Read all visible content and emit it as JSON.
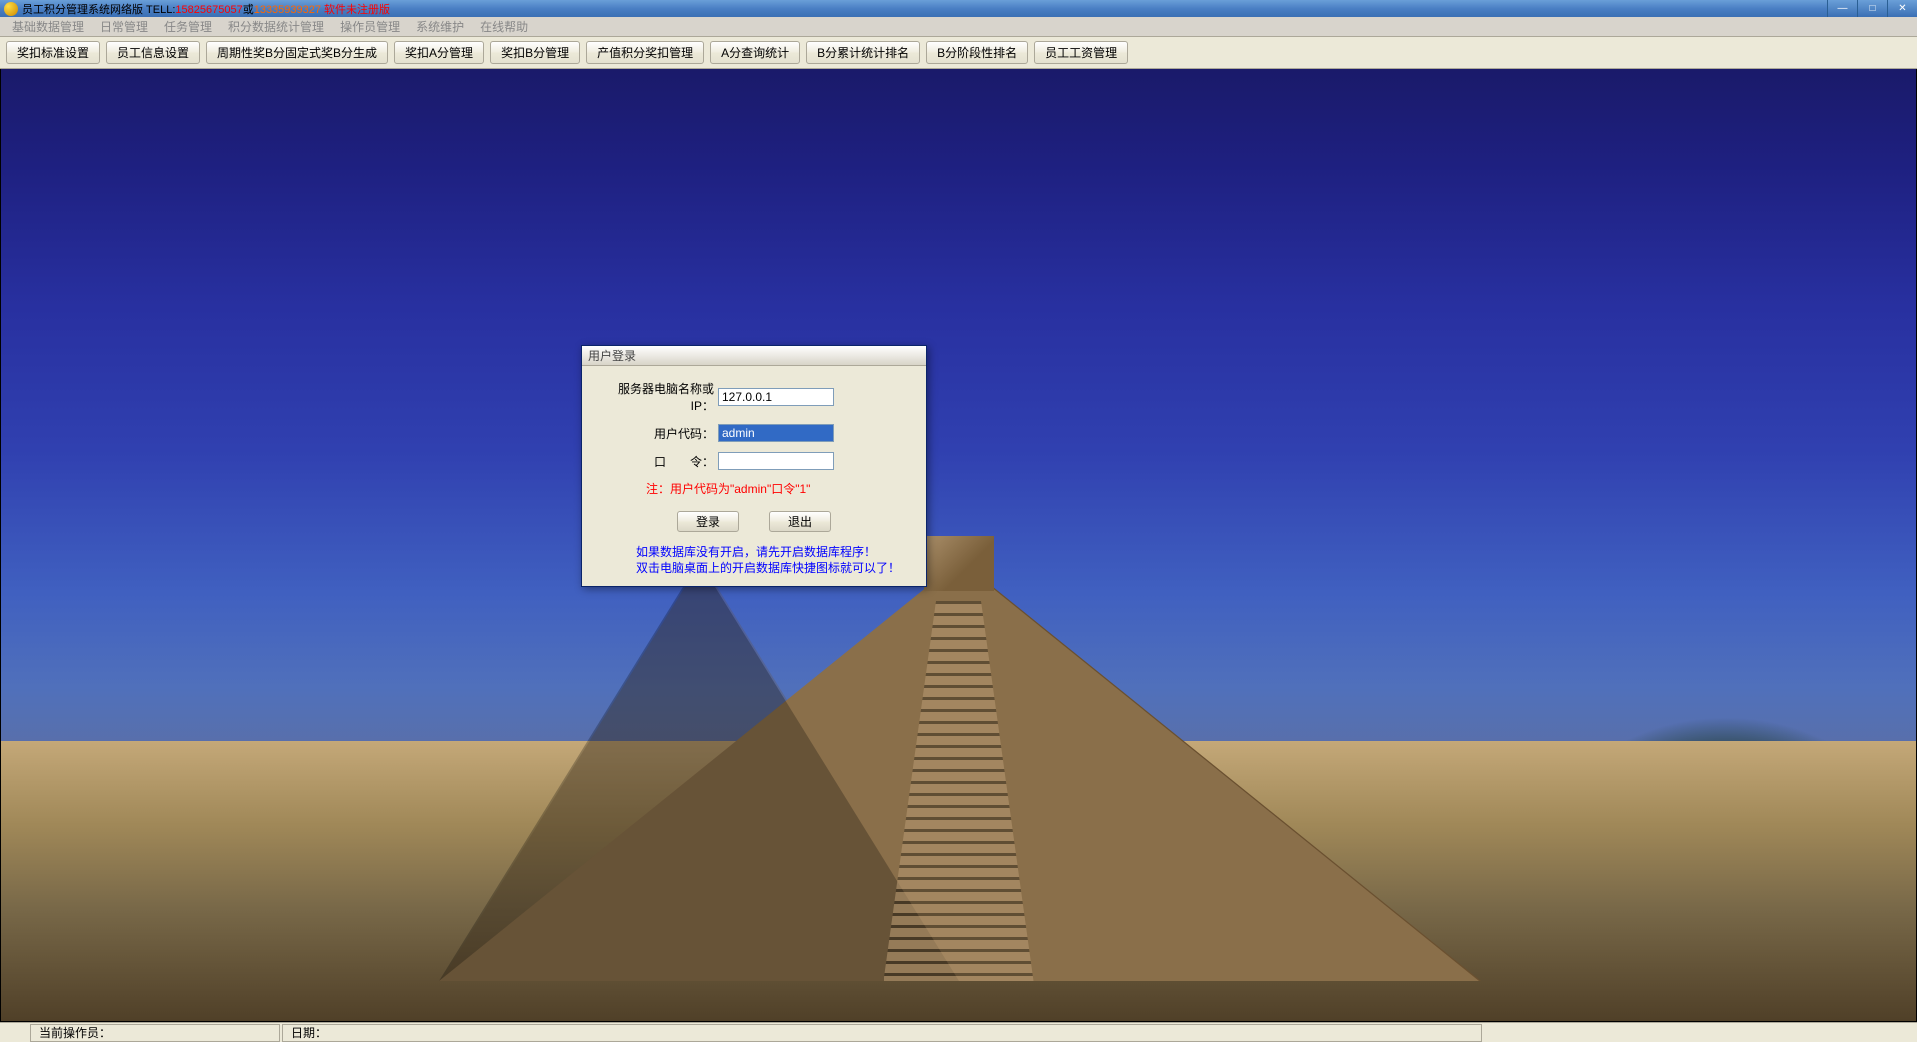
{
  "titlebar": {
    "prefix": "员工积分管理系统网络版 TELL:",
    "phone1": "15825675057",
    "connector": "或",
    "phone2": "13335939327",
    "suffix": " 软件未注册版"
  },
  "menubar": {
    "items": [
      "基础数据管理",
      "日常管理",
      "任务管理",
      "积分数据统计管理",
      "操作员管理",
      "系统维护",
      "在线帮助"
    ]
  },
  "toolbar": {
    "buttons": [
      "奖扣标准设置",
      "员工信息设置",
      "周期性奖B分固定式奖B分生成",
      "奖扣A分管理",
      "奖扣B分管理",
      "产值积分奖扣管理",
      "A分查询统计",
      "B分累计统计排名",
      "B分阶段性排名",
      "员工工资管理"
    ]
  },
  "dialog": {
    "title": "用户登录",
    "server_label": "服务器电脑名称或IP：",
    "server_value": "127.0.0.1",
    "user_label": "用户代码：",
    "user_value": "admin",
    "password_label": "口　　令：",
    "password_value": "",
    "note": "注：用户代码为\"admin\"口令\"1\"",
    "login_btn": "登录",
    "exit_btn": "退出",
    "help_line1": "如果数据库没有开启，请先开启数据库程序！",
    "help_line2": "双击电脑桌面上的开启数据库快捷图标就可以了！"
  },
  "statusbar": {
    "operator_label": "当前操作员：",
    "date_label": "日期："
  }
}
